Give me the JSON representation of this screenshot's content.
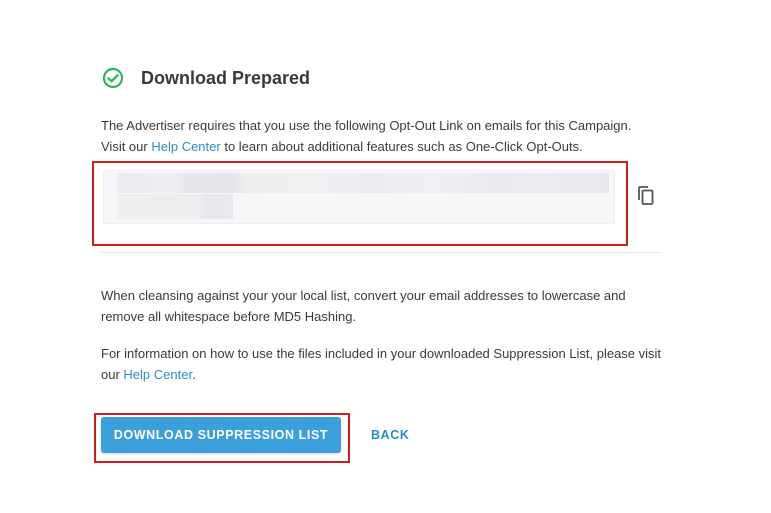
{
  "header": {
    "title": "Download Prepared",
    "icon": "check-circle-icon",
    "icon_color": "#2db35c"
  },
  "optout_notice": {
    "text_before_link_line1": "The Advertiser requires that you use the following Opt-Out Link on emails for this Campaign.",
    "text_before_link_line2": "Visit our ",
    "link_text": "Help Center",
    "text_after_link": " to learn about additional features such as One-Click Opt-Outs."
  },
  "optout_link": {
    "value": "",
    "copy_icon": "copy-icon"
  },
  "cleansing_note": {
    "text": "When cleansing against your your local list, convert your email addresses to lowercase and remove all whitespace before MD5 Hashing."
  },
  "files_info": {
    "text_before_link": "For information on how to use the files included in your downloaded Suppression List, please visit our ",
    "link_text": "Help Center",
    "text_after_link": "."
  },
  "actions": {
    "download_label": "DOWNLOAD SUPPRESSION LIST",
    "back_label": "BACK"
  },
  "colors": {
    "accent": "#3a9fda",
    "link": "#2a8dc9",
    "highlight": "#d41c1c",
    "success": "#2db35c"
  }
}
